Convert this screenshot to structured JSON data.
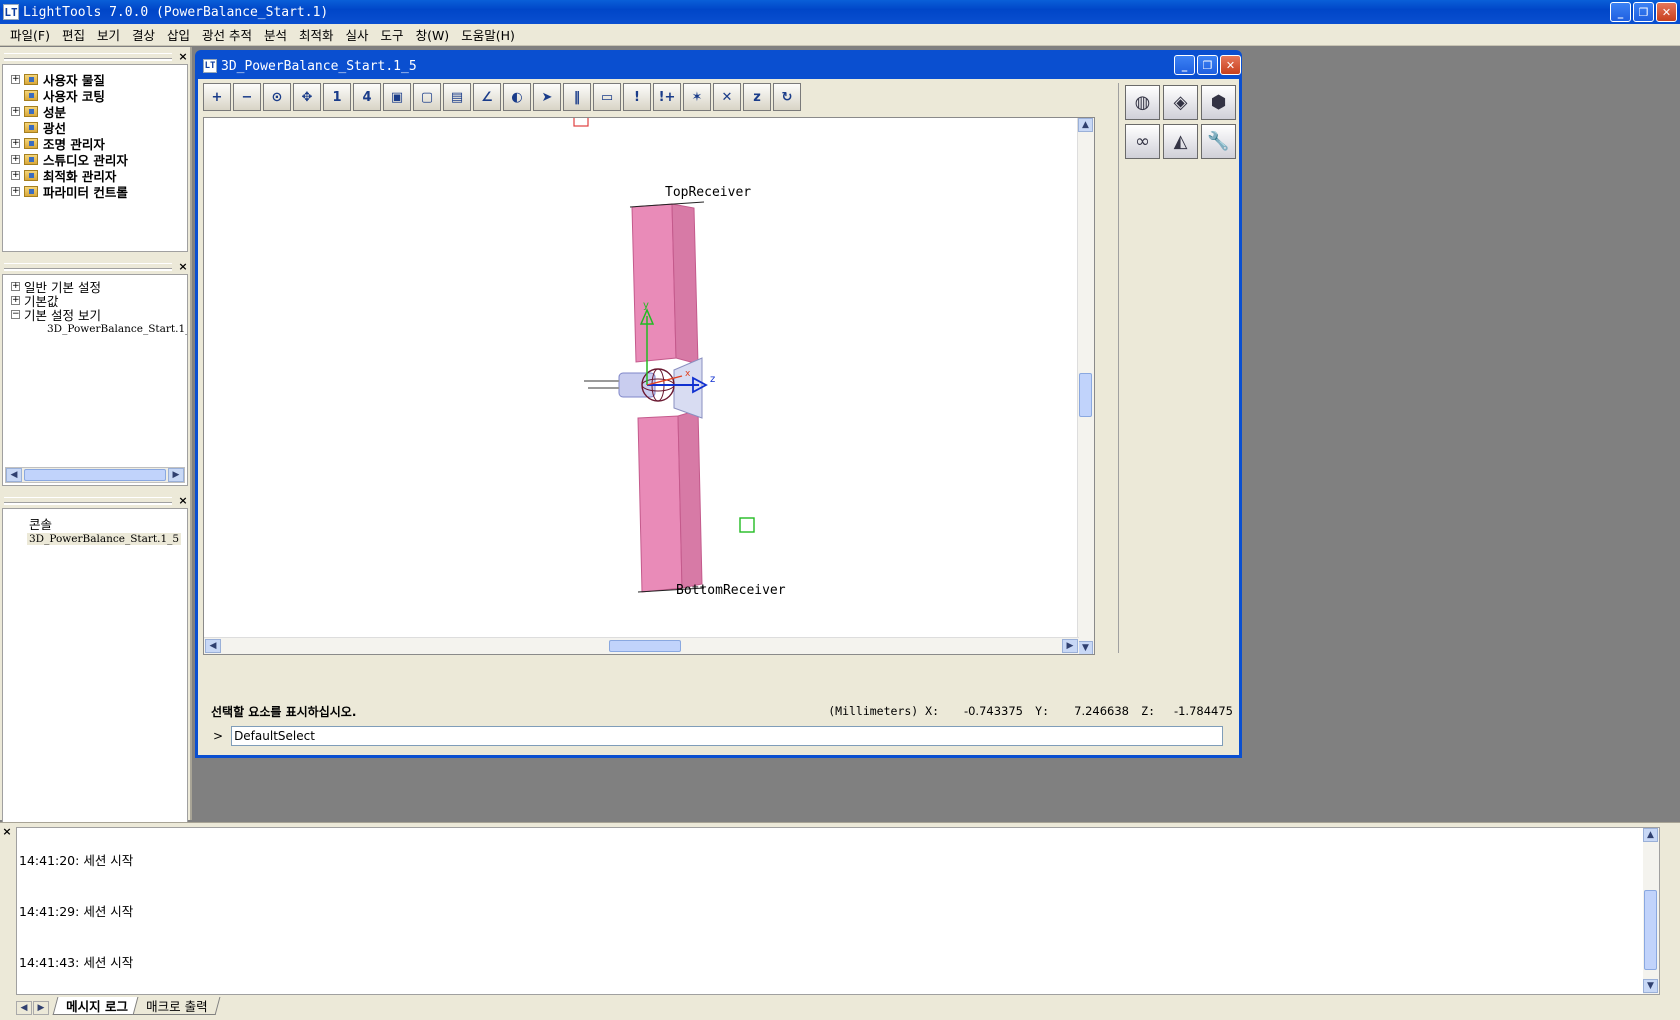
{
  "app": {
    "title": "LightTools 7.0.0   (PowerBalance_Start.1)",
    "icon_letter": "LT",
    "controls": {
      "minimize": "_",
      "restore": "❐",
      "close": "✕"
    }
  },
  "menu": [
    "파일(F)",
    "편집",
    "보기",
    "결상",
    "삽입",
    "광선 추적",
    "분석",
    "최적화",
    "실사",
    "도구",
    "창(W)",
    "도움말(H)"
  ],
  "tree_top": [
    {
      "label": "사용자 물질",
      "expander": "+"
    },
    {
      "label": "사용자 코팅",
      "expander": ""
    },
    {
      "label": "성분",
      "expander": "+"
    },
    {
      "label": "광선",
      "expander": ""
    },
    {
      "label": "조명 관리자",
      "expander": "+"
    },
    {
      "label": "스튜디오 관리자",
      "expander": "+"
    },
    {
      "label": "최적화 관리자",
      "expander": "+"
    },
    {
      "label": "파라미터 컨트롤",
      "expander": "+"
    }
  ],
  "tree_mid": [
    {
      "label": "일반 기본 설정",
      "expander": "+"
    },
    {
      "label": "기본값",
      "expander": "+"
    },
    {
      "label": "기본 설정 보기",
      "expander": "−"
    }
  ],
  "tree_mid_child": "3D_PowerBalance_Start.1_",
  "tree_bottom": {
    "root": "콘솔",
    "child": "3D_PowerBalance_Start.1_5"
  },
  "pane_close": "×",
  "doc": {
    "title": "3D_PowerBalance_Start.1_5",
    "labels": {
      "top": "TopReceiver",
      "bottom": "BottomReceiver",
      "axis_y": "y",
      "axis_z": "z",
      "axis_x": "x"
    },
    "status_text": "선택할 요소를 표시하십시오.",
    "coords_label": "(Millimeters) X:",
    "x_value": "-0.743375",
    "y_label": "Y:",
    "y_value": "7.246638",
    "z_label": "Z:",
    "z_value": "-1.784475",
    "prompt": ">",
    "command": "DefaultSelect"
  },
  "toolbar": [
    "+",
    "−",
    "⊙",
    "✥",
    "1",
    "4",
    "▣",
    "▢",
    "▤",
    "∠",
    "◐",
    "➤",
    "‖",
    "▭",
    "!",
    "!+",
    "✶",
    "✕",
    "z",
    "↻"
  ],
  "right_tools": [
    "◍",
    "◈",
    "⬢",
    "∞",
    "◭",
    "🔧"
  ],
  "log": {
    "lines": [
      "14:41:20: 세션 시작",
      "14:41:29: 세션 시작",
      "14:41:43: 세션 시작"
    ],
    "tabs": [
      "메시지 로그",
      "매크로 출력"
    ]
  },
  "colors": {
    "titlebar": "#0a4fd0",
    "part": "#e98bb8",
    "accent_y": "#22bb22",
    "accent_z": "#1030d0"
  }
}
